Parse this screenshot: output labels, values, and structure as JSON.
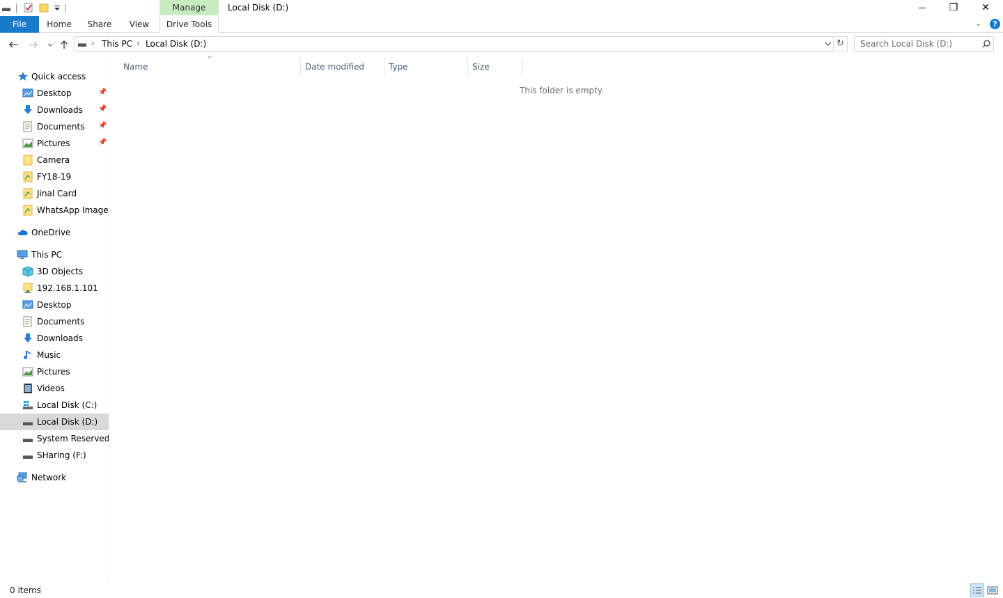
{
  "window": {
    "title": "Local Disk (D:)",
    "manage_tab": "Manage",
    "controls": {
      "minimize": "—",
      "restore": "❐",
      "close": "✕"
    }
  },
  "ribbon": {
    "tabs": [
      {
        "label": "File"
      },
      {
        "label": "Home"
      },
      {
        "label": "Share"
      },
      {
        "label": "View"
      },
      {
        "label": "Drive Tools"
      }
    ],
    "help_glyph": "?",
    "chevron_glyph": "⌄"
  },
  "addressbar": {
    "breadcrumb": [
      "This PC",
      "Local Disk (D:)"
    ],
    "separator": "›",
    "search_placeholder": "Search Local Disk (D:)"
  },
  "navpane": {
    "quick_access": {
      "label": "Quick access",
      "items": [
        {
          "label": "Desktop",
          "icon": "desktop-icon",
          "pinned": true
        },
        {
          "label": "Downloads",
          "icon": "downloads-icon",
          "pinned": true
        },
        {
          "label": "Documents",
          "icon": "documents-icon",
          "pinned": true
        },
        {
          "label": "Pictures",
          "icon": "pictures-icon",
          "pinned": true
        },
        {
          "label": "Camera",
          "icon": "folder-icon",
          "pinned": false
        },
        {
          "label": "FY18-19",
          "icon": "folder-icon",
          "pinned": false
        },
        {
          "label": "Jinal Card",
          "icon": "folder-icon",
          "pinned": false
        },
        {
          "label": "WhatsApp Images",
          "icon": "folder-icon",
          "pinned": false
        }
      ]
    },
    "onedrive": {
      "label": "OneDrive"
    },
    "this_pc": {
      "label": "This PC",
      "items": [
        {
          "label": "3D Objects",
          "icon": "3d-objects-icon"
        },
        {
          "label": "192.168.1.101",
          "icon": "network-drive-icon"
        },
        {
          "label": "Desktop",
          "icon": "desktop-icon"
        },
        {
          "label": "Documents",
          "icon": "documents-icon"
        },
        {
          "label": "Downloads",
          "icon": "downloads-icon"
        },
        {
          "label": "Music",
          "icon": "music-icon"
        },
        {
          "label": "Pictures",
          "icon": "pictures-icon"
        },
        {
          "label": "Videos",
          "icon": "videos-icon"
        },
        {
          "label": "Local Disk (C:)",
          "icon": "windows-drive-icon"
        },
        {
          "label": "Local Disk (D:)",
          "icon": "drive-icon",
          "selected": true
        },
        {
          "label": "System Reserved (E:",
          "icon": "drive-icon"
        },
        {
          "label": "SHaring (F:)",
          "icon": "drive-icon"
        }
      ]
    },
    "network": {
      "label": "Network"
    }
  },
  "content": {
    "columns": [
      "Name",
      "Date modified",
      "Type",
      "Size"
    ],
    "sort_glyph": "^",
    "empty_message": "This folder is empty."
  },
  "statusbar": {
    "item_count": "0 items"
  },
  "colors": {
    "file_tab": "#1979ca",
    "manage_tab": "#c8ebc1",
    "selected_item": "#d9d9d9",
    "column_header_text": "#4c607a"
  }
}
